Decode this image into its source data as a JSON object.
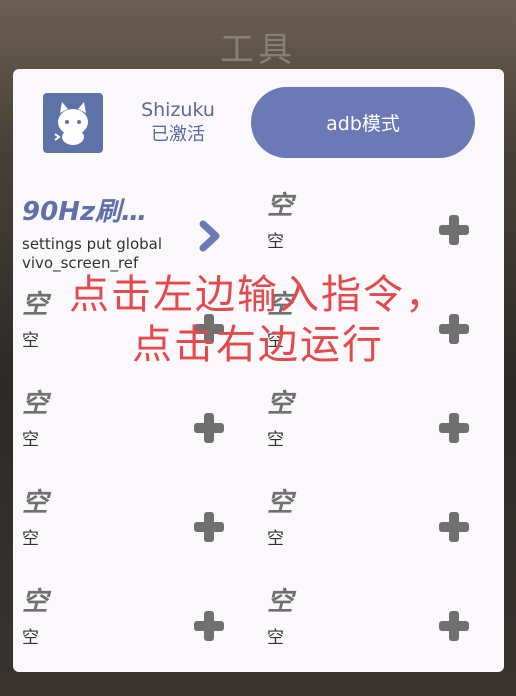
{
  "background": {
    "title": "工具"
  },
  "header": {
    "app_name": "Shizuku",
    "app_status": "已激活",
    "adb_button": "adb模式"
  },
  "slots": [
    {
      "title": "90Hz刷…",
      "command_line1": "settings put global",
      "command_line2": "vivo_screen_ref",
      "action": "run"
    },
    {
      "title": "空",
      "command": "空",
      "action": "add"
    },
    {
      "title": "空",
      "command": "空",
      "action": "add"
    },
    {
      "title": "空",
      "command": "空",
      "action": "add"
    },
    {
      "title": "空",
      "command": "空",
      "action": "add"
    },
    {
      "title": "空",
      "command": "空",
      "action": "add"
    },
    {
      "title": "空",
      "command": "空",
      "action": "add"
    },
    {
      "title": "空",
      "command": "空",
      "action": "add"
    },
    {
      "title": "空",
      "command": "空",
      "action": "add"
    },
    {
      "title": "空",
      "command": "空",
      "action": "add"
    }
  ],
  "overlay": {
    "line1": "点击左边输入指令，",
    "line2": "点击右边运行"
  },
  "colors": {
    "accent": "#6b79b6",
    "overlay_text": "#e34a4e",
    "plus_icon": "#707070"
  }
}
